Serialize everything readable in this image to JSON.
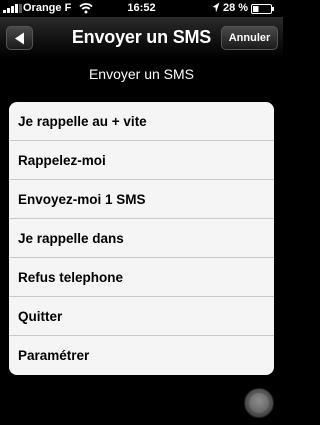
{
  "status_bar": {
    "carrier": "Orange F",
    "time": "16:52",
    "battery_percent": "28 %"
  },
  "nav_bar": {
    "title": "Envoyer un SMS",
    "cancel_label": "Annuler"
  },
  "section_title": "Envoyer un SMS",
  "menu_items": [
    "Je rappelle au + vite",
    "Rappelez-moi",
    "Envoyez-moi 1 SMS",
    "Je rappelle dans",
    "Refus telephone",
    "Quitter",
    "Paramétrer"
  ],
  "icons": {
    "back": "back-arrow-icon",
    "signal": "signal-bars-icon",
    "wifi": "wifi-icon",
    "location": "location-arrow-icon",
    "battery": "battery-icon",
    "home": "home-button-icon"
  }
}
